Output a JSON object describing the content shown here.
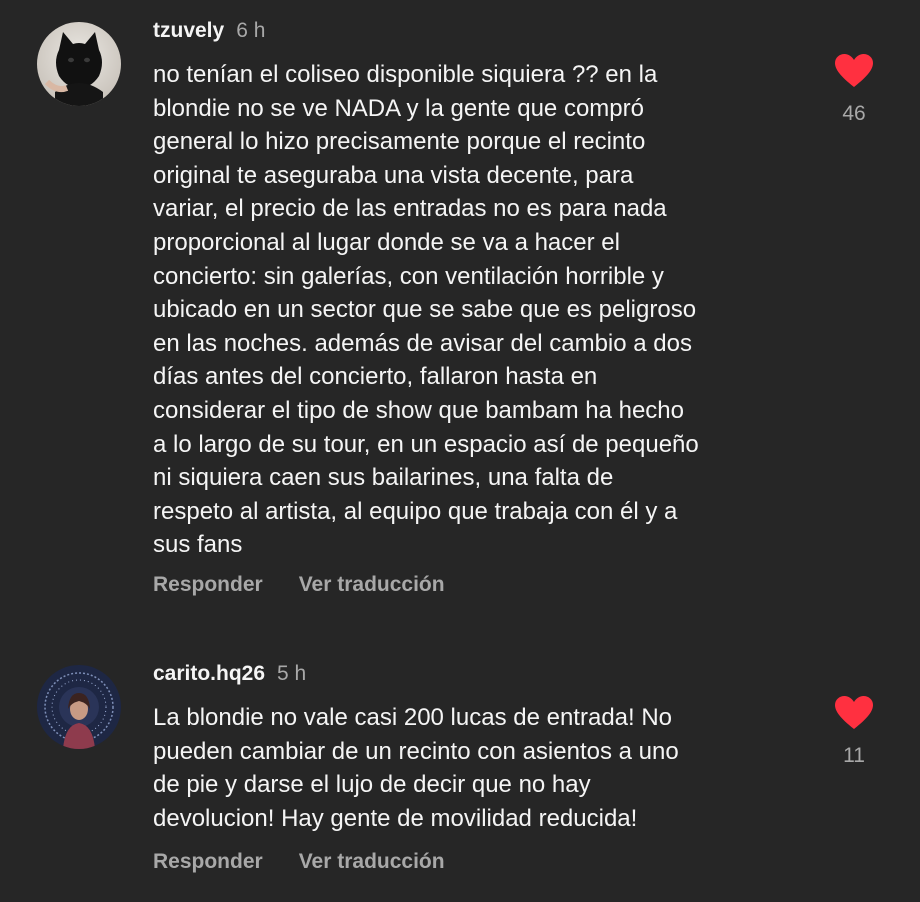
{
  "colors": {
    "background": "#262626",
    "text_primary": "#f5f5f5",
    "text_secondary": "#a8a8a8",
    "like_active": "#ff3040"
  },
  "comments": [
    {
      "username": "tzuvely",
      "time": "6 h",
      "text": "no tenían el coliseo disponible siquiera ?? en la\nblondie no se ve NADA y la gente que compró\ngeneral lo hizo precisamente porque el recinto\noriginal te aseguraba una vista decente, para\nvariar, el precio de las entradas no es para nada\nproporcional al lugar donde se va a hacer el\nconcierto: sin galerías, con ventilación horrible y\nubicado en un sector que se sabe que es peligroso\nen las noches. además de avisar del cambio a dos\ndías antes del concierto, fallaron hasta en\nconsiderar el tipo de show que bambam ha hecho\na lo largo de su tour, en un espacio así de pequeño\nni siquiera caen sus bailarines, una falta de\nrespeto al artista, al equipo que trabaja con él y a\nsus fans",
      "reply_label": "Responder",
      "translate_label": "Ver traducción",
      "likes": "46",
      "liked": true,
      "like_icon": "heart-filled-icon"
    },
    {
      "username": "carito.hq26",
      "time": "5 h",
      "text": "La blondie no vale casi 200 lucas de entrada! No\npueden cambiar de un recinto con asientos a uno\nde pie y darse el lujo de decir que no hay\ndevolucion! Hay gente de movilidad reducida!",
      "reply_label": "Responder",
      "translate_label": "Ver traducción",
      "likes": "11",
      "liked": true,
      "like_icon": "heart-filled-icon"
    }
  ]
}
